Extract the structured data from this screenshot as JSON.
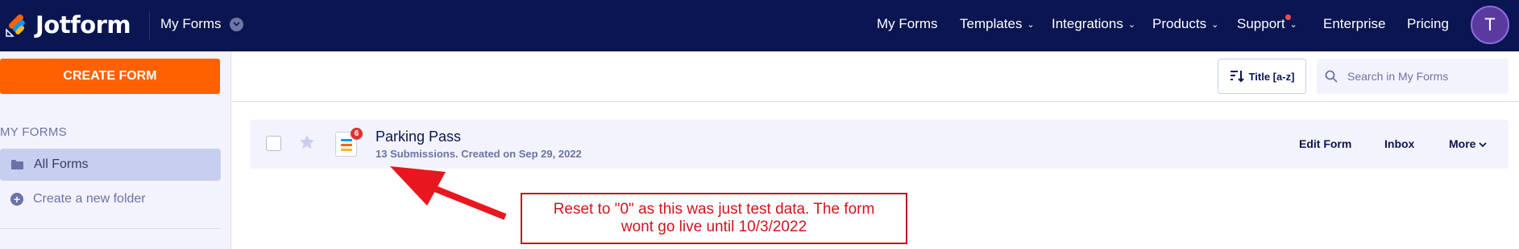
{
  "brand": {
    "name": "Jotform"
  },
  "topbar": {
    "section_label": "My Forms",
    "nav": [
      {
        "label": "My Forms"
      },
      {
        "label": "Templates"
      },
      {
        "label": "Integrations"
      },
      {
        "label": "Products"
      },
      {
        "label": "Support"
      },
      {
        "label": "Enterprise"
      },
      {
        "label": "Pricing"
      }
    ],
    "avatar_initial": "T",
    "colors": {
      "bg": "#0a1551",
      "avatar": "#5b3aa0",
      "support_dot": "#ff4948"
    }
  },
  "sidebar": {
    "create_button": "CREATE FORM",
    "heading": "MY FORMS",
    "active_item": "All Forms",
    "new_folder": "Create a new folder",
    "colors": {
      "create": "#ff6100",
      "active_bg": "#c8ceed"
    }
  },
  "toolbar": {
    "sort_label": "Title [a-z]",
    "search_placeholder": "Search in My Forms"
  },
  "forms": [
    {
      "title": "Parking Pass",
      "meta": "13 Submissions. Created on Sep 29, 2022",
      "badge": "6",
      "actions": {
        "edit": "Edit Form",
        "inbox": "Inbox",
        "more": "More"
      }
    }
  ],
  "annotation": {
    "line1": "Reset to \"0\" as this was just test data. The form",
    "line2": "wont go live until 10/3/2022",
    "color": "#d0141e"
  }
}
